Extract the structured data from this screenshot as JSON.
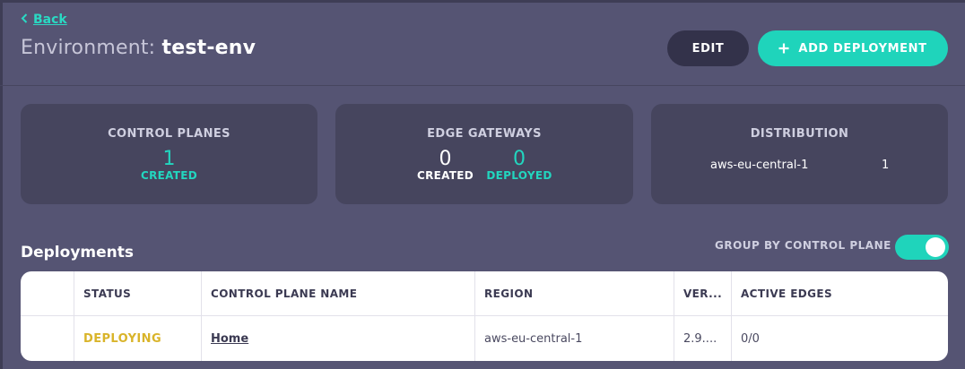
{
  "nav": {
    "back_label": "Back"
  },
  "header": {
    "title_prefix": "Environment: ",
    "env_name": "test-env",
    "edit_label": "EDIT",
    "add_label": "ADD DEPLOYMENT"
  },
  "cards": {
    "control_planes": {
      "title": "CONTROL PLANES",
      "created_value": "1",
      "created_label": "CREATED"
    },
    "edge_gateways": {
      "title": "EDGE GATEWAYS",
      "created_value": "0",
      "created_label": "CREATED",
      "deployed_value": "0",
      "deployed_label": "DEPLOYED"
    },
    "distribution": {
      "title": "DISTRIBUTION",
      "region": "aws-eu-central-1",
      "count": "1"
    }
  },
  "deployments": {
    "title": "Deployments",
    "group_label": "GROUP BY CONTROL PLANE",
    "group_enabled": true,
    "columns": [
      "STATUS",
      "CONTROL PLANE NAME",
      "REGION",
      "VER...",
      "ACTIVE EDGES"
    ],
    "rows": [
      {
        "status": "DEPLOYING",
        "name": "Home",
        "region": "aws-eu-central-1",
        "version": "2.9....",
        "active_edges": "0/0"
      }
    ]
  },
  "colors": {
    "background": "#555473",
    "card": "#46455e",
    "accent": "#1fd4bb",
    "status_deploying": "#d9b42a"
  }
}
